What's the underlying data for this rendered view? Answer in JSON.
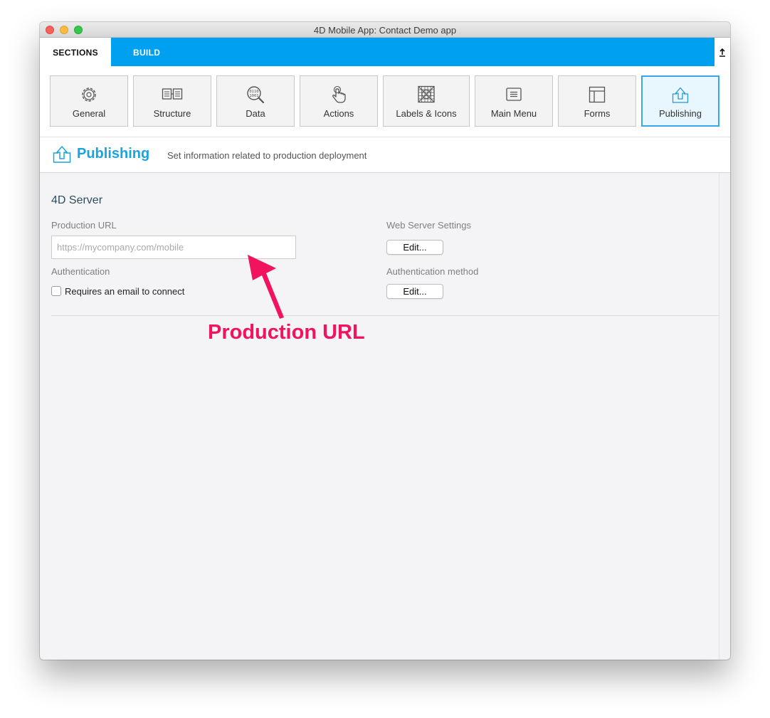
{
  "window": {
    "title": "4D Mobile App: Contact Demo app"
  },
  "tabs": {
    "sections": "SECTIONS",
    "build": "BUILD"
  },
  "sections": [
    {
      "label": "General",
      "icon": "gear-icon"
    },
    {
      "label": "Structure",
      "icon": "structure-icon"
    },
    {
      "label": "Data",
      "icon": "data-magnifier-icon"
    },
    {
      "label": "Actions",
      "icon": "pointing-hand-icon"
    },
    {
      "label": "Labels & Icons",
      "icon": "labels-icons-grid-icon"
    },
    {
      "label": "Main Menu",
      "icon": "menu-list-icon"
    },
    {
      "label": "Forms",
      "icon": "form-layout-icon"
    },
    {
      "label": "Publishing",
      "icon": "upload-tray-icon",
      "active": true
    }
  ],
  "header": {
    "title": "Publishing",
    "subtitle": "Set information related to production deployment"
  },
  "server": {
    "group_title": "4D Server",
    "production_url_label": "Production URL",
    "production_url_value": "",
    "production_url_placeholder": "https://mycompany.com/mobile",
    "web_server_label": "Web Server Settings",
    "web_server_button": "Edit...",
    "authentication_label": "Authentication",
    "email_checkbox_label": "Requires an email to connect",
    "email_checkbox_checked": false,
    "auth_method_label": "Authentication method",
    "auth_method_button": "Edit..."
  },
  "annotation": {
    "text": "Production URL",
    "color": "#f2135f"
  },
  "colors": {
    "accent": "#00a0f0",
    "header_title": "#1ba3e0",
    "active_border": "#3aa6e8"
  }
}
